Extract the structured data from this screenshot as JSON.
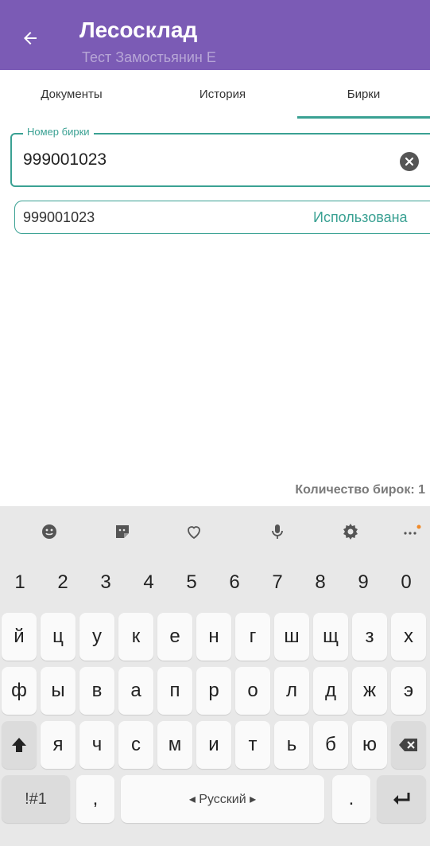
{
  "app_bar": {
    "title": "Лесосклад",
    "subtitle": "Тест Замостьянин Е"
  },
  "tabs": [
    {
      "label": "Документы"
    },
    {
      "label": "История"
    },
    {
      "label": "Бирки",
      "active": true
    }
  ],
  "tag_field": {
    "label": "Номер бирки",
    "value": "999001023"
  },
  "result": {
    "number": "999001023",
    "status": "Использована"
  },
  "footer": {
    "count_text": "Количество бирок: 1"
  },
  "keyboard": {
    "toolbar": [
      "emoji-icon",
      "sticker-icon",
      "heart-icon",
      "mic-icon",
      "gear-icon",
      "more-icon"
    ],
    "row_numbers": [
      "1",
      "2",
      "3",
      "4",
      "5",
      "6",
      "7",
      "8",
      "9",
      "0"
    ],
    "row1": [
      "й",
      "ц",
      "у",
      "к",
      "е",
      "н",
      "г",
      "ш",
      "щ",
      "з",
      "х"
    ],
    "row2": [
      "ф",
      "ы",
      "в",
      "а",
      "п",
      "р",
      "о",
      "л",
      "д",
      "ж",
      "э"
    ],
    "row3": [
      "я",
      "ч",
      "с",
      "м",
      "и",
      "т",
      "ь",
      "б",
      "ю"
    ],
    "symbols_label": "!#1",
    "comma_label": ",",
    "space_label": "◂ Русский ▸",
    "period_label": "."
  },
  "colors": {
    "app_bar": "#7b5bb5",
    "accent": "#3aa193"
  }
}
